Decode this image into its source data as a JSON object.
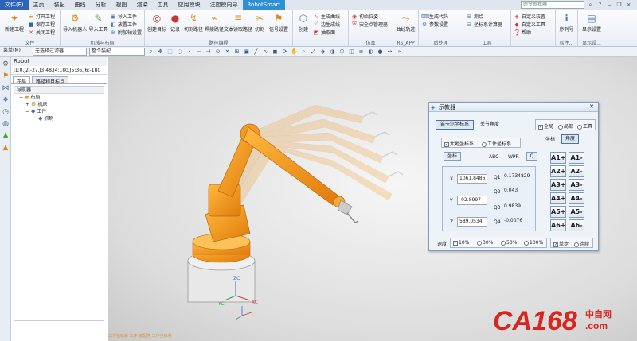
{
  "menubar": {
    "file": "文件(F)",
    "items": [
      "主页",
      "装配",
      "曲线",
      "分析",
      "视图",
      "渲染",
      "工具",
      "应用模块",
      "注塑模向导"
    ],
    "active": "RobotSmart",
    "search_placeholder": "命令查找器"
  },
  "ribbon": {
    "groups": [
      {
        "label": "文件",
        "big": [
          {
            "label": "新建工程",
            "icon": "new-project-icon"
          }
        ],
        "small": [
          "打开工程",
          "保存工程",
          "关闭工程"
        ]
      },
      {
        "label": "机械与布局",
        "big": [
          {
            "label": "导入机器人",
            "icon": "robot-icon"
          },
          {
            "label": "导入工具",
            "icon": "tool-icon"
          }
        ],
        "small": [
          "导入工件",
          "放置工件",
          "附加轴设置"
        ]
      },
      {
        "label": "路径编程",
        "big": [
          {
            "label": "创建目标",
            "icon": "target-icon"
          },
          {
            "label": "记录",
            "icon": "record-icon"
          },
          {
            "label": "切割路径",
            "icon": "cut-path-icon"
          },
          {
            "label": "焊接路径",
            "icon": "weld-path-icon"
          },
          {
            "label": "文本读取路径",
            "icon": "text-path-icon"
          },
          {
            "label": "切割",
            "icon": "cut-icon"
          },
          {
            "label": "信号设置",
            "icon": "signal-icon"
          }
        ]
      },
      {
        "label": "",
        "big": [
          {
            "label": "创建",
            "icon": "create-icon"
          }
        ],
        "small": [
          "生成曲线",
          "边生成线",
          "抽取面"
        ]
      },
      {
        "label": "仿真",
        "big": [],
        "small": [
          "初始位姿",
          "安全点管理器"
        ]
      },
      {
        "label": "RS_APP",
        "big": [
          {
            "label": "曲线轨迹",
            "icon": "curve-track-icon"
          }
        ]
      },
      {
        "label": "后处理",
        "big": [],
        "small": [
          "生成代码",
          "参数设置"
        ]
      },
      {
        "label": "工具",
        "big": [],
        "small": [
          "测绘",
          "坐标系计算器"
        ]
      },
      {
        "label": "",
        "big": [],
        "small": [
          "自定义装置",
          "自定义工具",
          "帮助"
        ]
      },
      {
        "label": "软件...",
        "big": [
          {
            "label": "序列号",
            "icon": "serial-icon"
          }
        ]
      },
      {
        "label": "显示设...",
        "big": [
          {
            "label": "显示设置",
            "icon": "display-settings-icon"
          }
        ]
      }
    ]
  },
  "toolbar": {
    "menu_label": "菜单(M)",
    "filter_value": "无选择过滤器",
    "assembly_value": "整个装配"
  },
  "panel": {
    "title": "Robot",
    "joints": "J1:0,J2:-27,J3:48,J4:180,J5:36,J6:-180",
    "tabs": [
      "布局",
      "路径和目标点"
    ],
    "tree_header": "导航器",
    "tree": [
      {
        "label": "布局",
        "level": 0,
        "icon": "folder-icon"
      },
      {
        "label": "机床",
        "level": 1,
        "icon": "machine-icon"
      },
      {
        "label": "工件",
        "level": 1,
        "icon": "workpiece-icon"
      },
      {
        "label": "抓刷",
        "level": 2,
        "icon": "brush-icon"
      }
    ]
  },
  "dialog": {
    "title": "示教器",
    "tab_cartesian": "笛卡尔坐标系",
    "tab_joint": "关节角度",
    "ref_modes": [
      "全局",
      "局部",
      "工具"
    ],
    "sub_tab_coord": "坐标",
    "sub_tab_angle": "角度",
    "frame_modes": [
      "大地坐标系",
      "工件坐标系"
    ],
    "coord_button": "坐标",
    "headers": [
      "ABC",
      "WPR",
      "Q"
    ],
    "coords": [
      {
        "label": "X",
        "value": "1061.8486"
      },
      {
        "label": "Y",
        "value": "-92.8997"
      },
      {
        "label": "Z",
        "value": "589.0534"
      }
    ],
    "quats": [
      {
        "label": "Q1",
        "value": "0.1734829"
      },
      {
        "label": "Q2",
        "value": "0.043"
      },
      {
        "label": "Q3",
        "value": "0.9839"
      },
      {
        "label": "Q4",
        "value": "-0.0076"
      }
    ],
    "axis_buttons": [
      [
        "A1+",
        "A1-"
      ],
      [
        "A2+",
        "A2-"
      ],
      [
        "A3+",
        "A3-"
      ],
      [
        "A4+",
        "A4-"
      ],
      [
        "A5+",
        "A5-"
      ],
      [
        "A6+",
        "A6-"
      ]
    ],
    "speed_label": "速度",
    "speeds": [
      "10%",
      "30%",
      "50%",
      "100%"
    ],
    "step_modes": [
      "单步",
      "连续"
    ]
  },
  "viewport": {
    "status_text": "工作坐标系 工件 装配件 工作坐标系",
    "axis_labels": [
      "ZC",
      "XC",
      "YC"
    ]
  },
  "watermark": {
    "brand": "CA168",
    "suffix": ".com",
    "cn": "中自网"
  }
}
